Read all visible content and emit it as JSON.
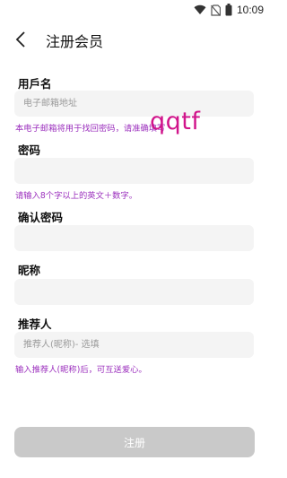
{
  "status_bar": {
    "time": "10:09",
    "icons": [
      "wifi-icon",
      "no-sim-icon",
      "battery-icon"
    ]
  },
  "app_bar": {
    "back_icon": "back-arrow-icon",
    "title": "注册会员"
  },
  "form": {
    "username": {
      "label": "用戶名",
      "value": "",
      "placeholder": "电子邮箱地址",
      "hint": "本电子邮箱将用于找回密码，请准确填写"
    },
    "password": {
      "label": "密码",
      "value": "",
      "placeholder": "",
      "hint": "请输入8个字以上的英文＋数字。"
    },
    "confirm_password": {
      "label": "确认密码",
      "value": "",
      "placeholder": ""
    },
    "nickname": {
      "label": "昵称",
      "value": "",
      "placeholder": ""
    },
    "referrer": {
      "label": "推荐人",
      "value": "",
      "placeholder": "推荐人(昵称)- 选填",
      "hint": "输入推荐人(昵称)后，可互送爱心。"
    }
  },
  "overlay_text": "qqtf",
  "submit_label": "注册",
  "colors": {
    "hint": "#9b2fbd",
    "overlay": "#d1148b",
    "field_bg": "#f4f4f4",
    "button_disabled": "#c9c9c9"
  }
}
